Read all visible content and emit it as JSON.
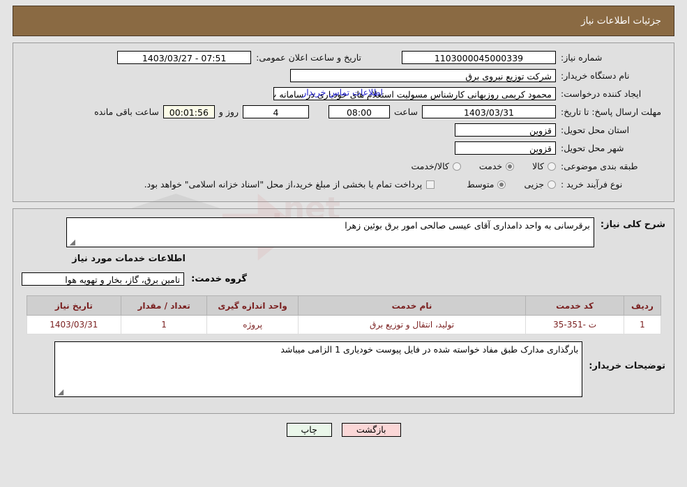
{
  "header": {
    "title": "جزئیات اطلاعات نیاز"
  },
  "form": {
    "need_number_label": "شماره نیاز:",
    "need_number_value": "1103000045000339",
    "announce_label": "تاریخ و ساعت اعلان عمومی:",
    "announce_value": "07:51 - 1403/03/27",
    "buyer_org_label": "نام دستگاه خریدار:",
    "buyer_org_value": "شرکت توزیع نیروی برق",
    "blank_value": "",
    "creator_label": "ایجاد کننده درخواست:",
    "creator_value": "محمود کریمی روزبهانی کارشناس  مسولیت استعلام های خودیاری در سامانه ت",
    "contact_link": "اطلاعات تماس خریدار",
    "deadline_label": "مهلت ارسال پاسخ: تا تاریخ:",
    "deadline_date": "1403/03/31",
    "hour_label": "ساعت",
    "deadline_time": "08:00",
    "days_value": "4",
    "days_label": "روز و",
    "countdown_value": "00:01:56",
    "remaining_label": "ساعت باقی مانده",
    "province_label": "استان محل تحویل:",
    "province_value": "قزوین",
    "city_label": "شهر محل تحویل:",
    "city_value": "قزوین",
    "category_label": "طبقه بندی موضوعی:",
    "category_options": [
      {
        "label": "کالا",
        "selected": false
      },
      {
        "label": "خدمت",
        "selected": true
      },
      {
        "label": "کالا/خدمت",
        "selected": false
      }
    ],
    "process_label": "نوع فرآیند خرید :",
    "process_options": [
      {
        "label": "جزیی",
        "selected": false
      },
      {
        "label": "متوسط",
        "selected": true
      }
    ],
    "treasury_checkbox_checked": false,
    "treasury_text": "پرداخت تمام یا بخشی از مبلغ خرید،از محل \"اسناد خزانه اسلامی\" خواهد بود."
  },
  "details": {
    "summary_label": "شرح کلی نیاز:",
    "summary_value": "برقرسانی به واحد دامداری آقای عیسی صالحی امور برق بوئین زهرا",
    "services_heading": "اطلاعات خدمات مورد نیاز",
    "service_group_label": "گروه خدمت:",
    "service_group_value": "تامین برق، گاز، بخار و تهویه هوا",
    "table": {
      "columns": [
        "ردیف",
        "کد خدمت",
        "نام خدمت",
        "واحد اندازه گیری",
        "تعداد / مقدار",
        "تاریخ نیاز"
      ],
      "rows": [
        {
          "row": "1",
          "code": "ت -351-35",
          "name": "تولید، انتقال و توزیع برق",
          "unit": "پروژه",
          "qty": "1",
          "date": "1403/03/31"
        }
      ]
    },
    "buyer_notes_label": "توضیحات خریدار:",
    "buyer_notes_value": "بارگذاری مدارک طبق مفاد خواسته شده در فایل پیوست خودیاری 1 الزامی میباشد"
  },
  "footer": {
    "print_label": "چاپ",
    "back_label": "بازگشت"
  },
  "watermark": {
    "text": "AnaTender",
    "text2": ".net"
  },
  "colors": {
    "header_bg": "#8a6a43",
    "panel_bg": "#e0e0e0",
    "link": "#2222cc",
    "table_header_bg": "#cfcfcf",
    "table_text": "#7a1f1f",
    "print_btn": "#eaf7ea",
    "back_btn": "#fbd7d7",
    "countdown_bg": "#fbfbe8"
  }
}
